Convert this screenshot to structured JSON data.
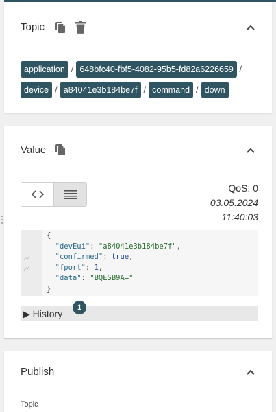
{
  "topic": {
    "title": "Topic",
    "segments": [
      "application",
      "648bfc40-fbf5-4082-95b5-fd82a6226659",
      "device",
      "a84041e3b184be7f",
      "command",
      "down"
    ]
  },
  "value": {
    "title": "Value",
    "qos": "QoS: 0",
    "date": "03.05.2024",
    "time": "11:40:03",
    "code": {
      "open": "{",
      "k1": "\"devEui\"",
      "v1": "\"a84041e3b184be7f\"",
      "k2": "\"confirmed\"",
      "v2": "true",
      "k3": "\"fport\"",
      "v3": "1",
      "k4": "\"data\"",
      "v4": "\"BQESB9A=\"",
      "close": "}"
    },
    "history_label": "▶ History",
    "history_count": "1"
  },
  "publish": {
    "title": "Publish",
    "topic_label": "Topic"
  },
  "icons": {
    "copy": "copy-icon",
    "delete": "trash-icon",
    "collapse": "chevron-up-icon",
    "code": "code-icon",
    "raw": "list-icon"
  },
  "colors": {
    "accent": "#2f5563",
    "chip_text": "#ffffff"
  }
}
